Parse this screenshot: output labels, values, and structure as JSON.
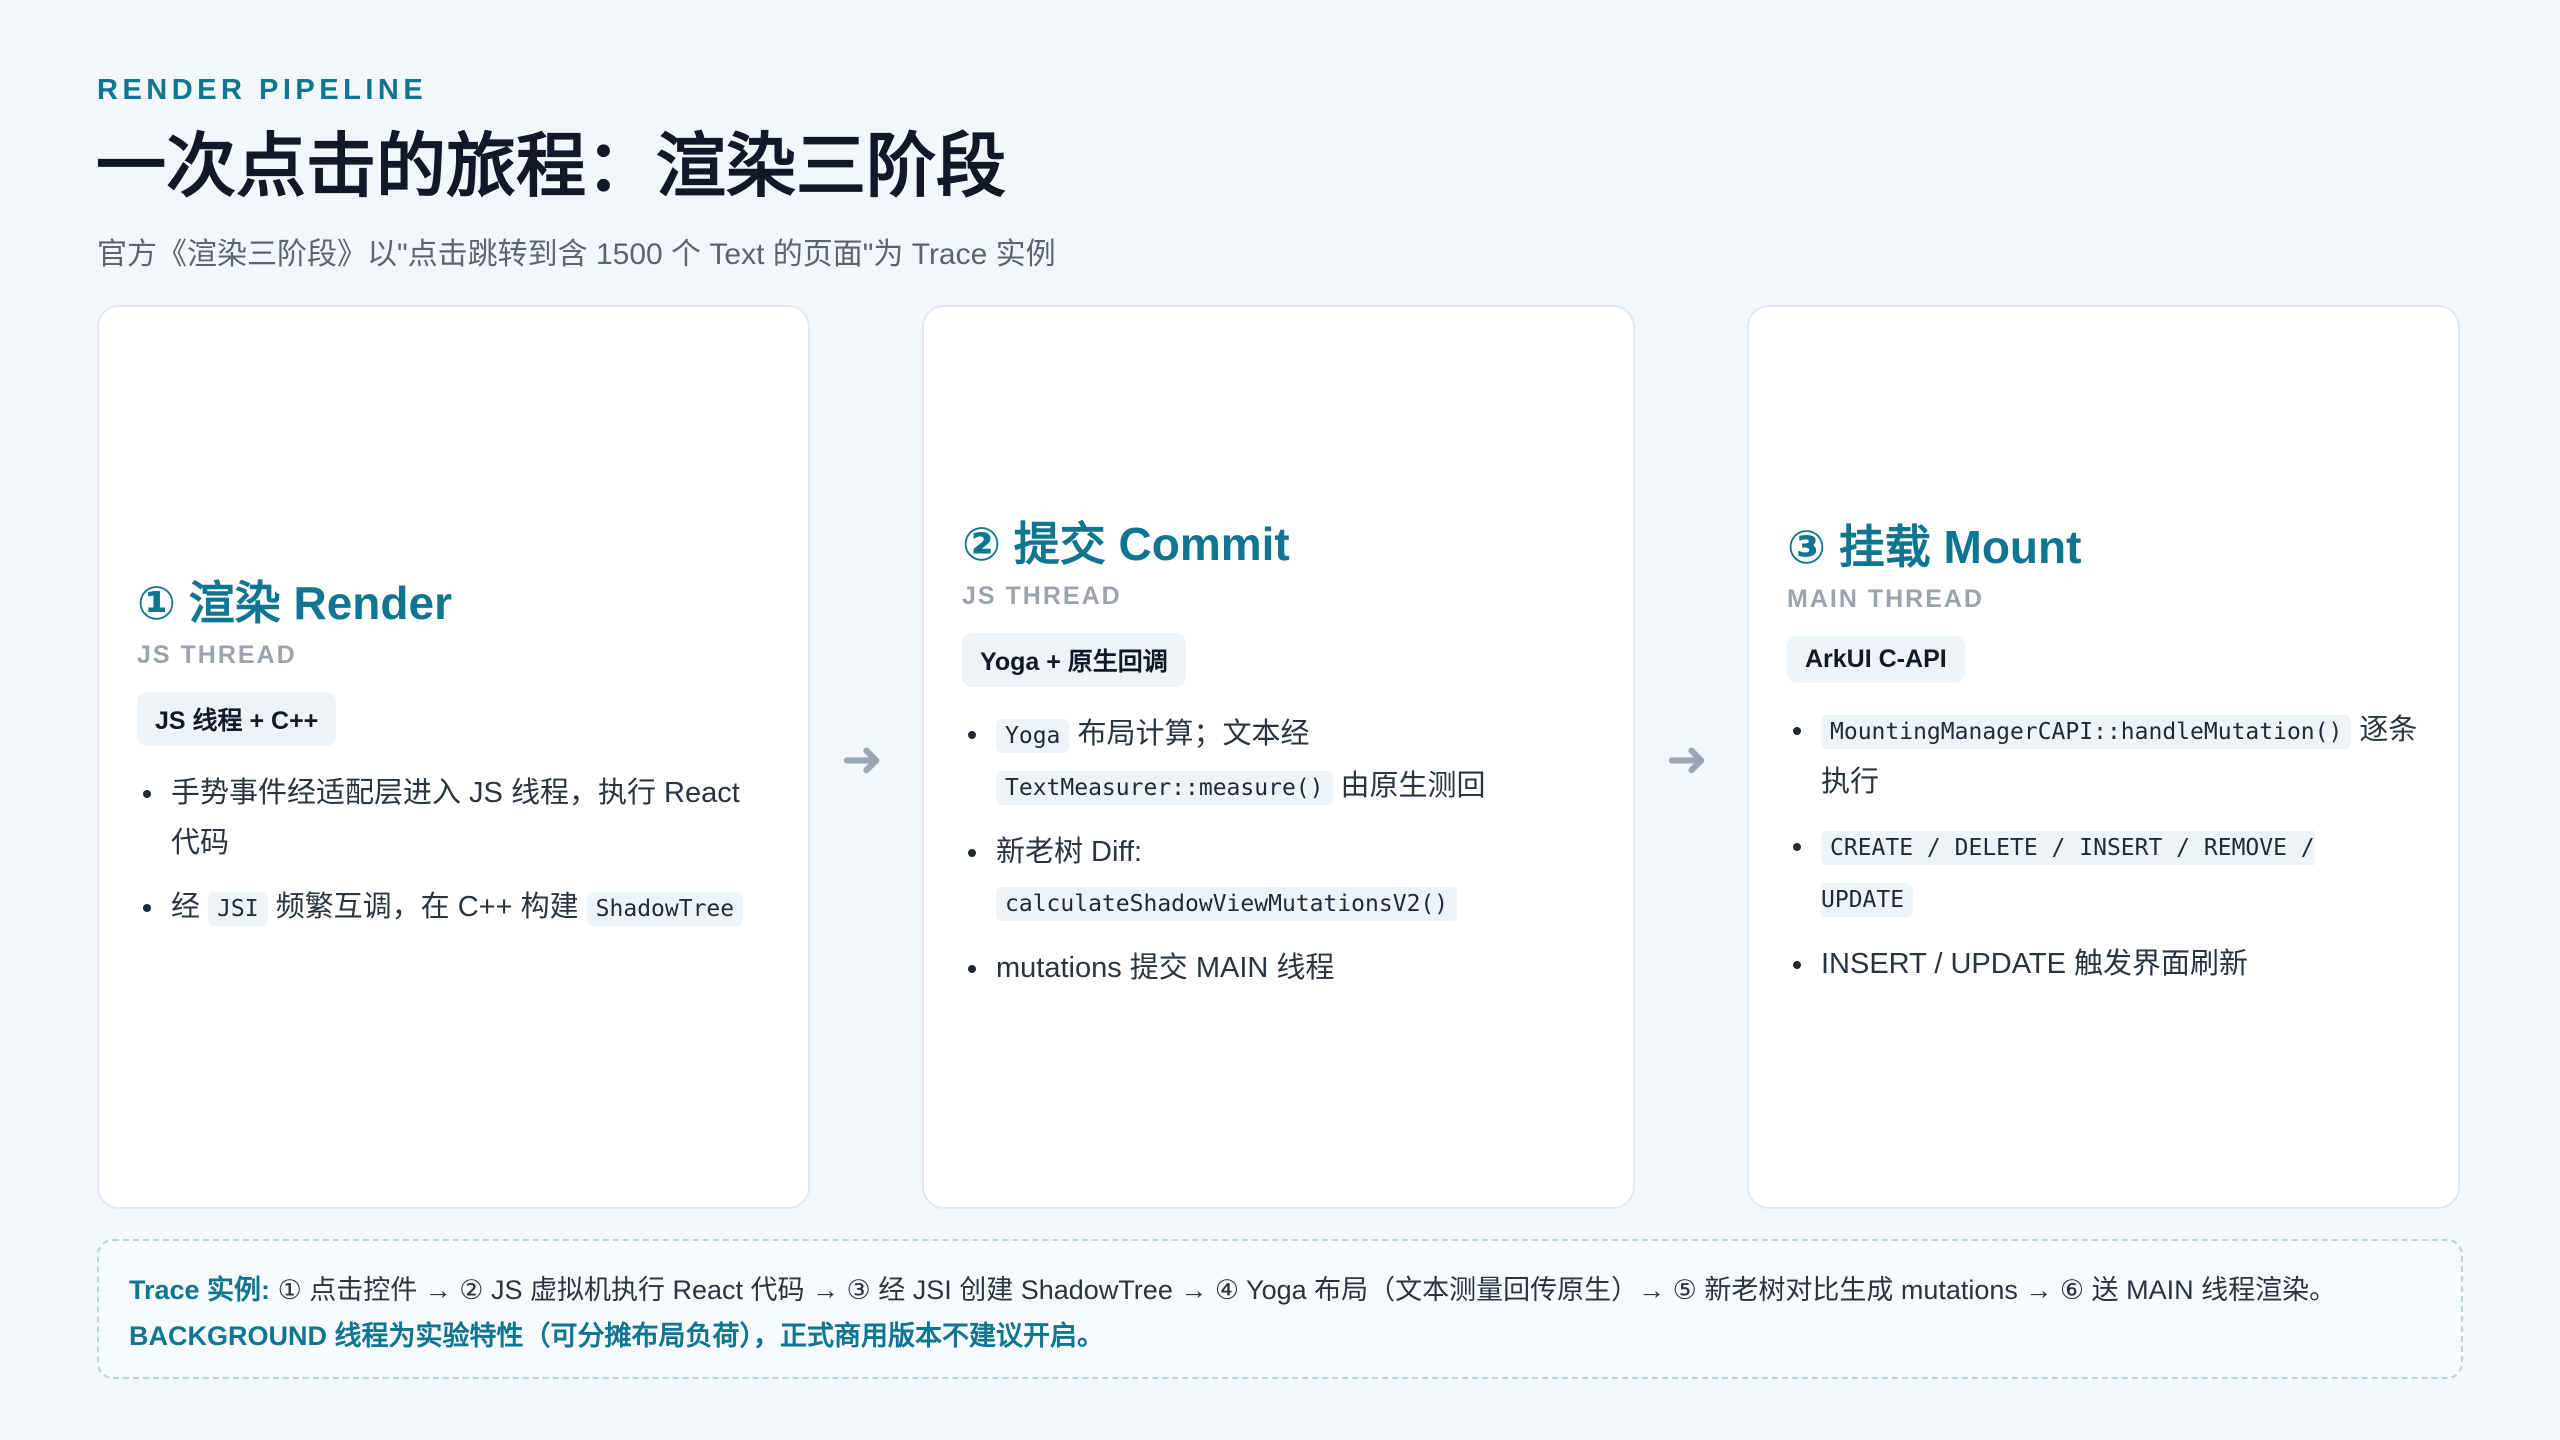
{
  "header": {
    "eyebrow": "RENDER PIPELINE",
    "title": "一次点击的旅程：渲染三阶段",
    "subtitle": "官方《渲染三阶段》以\"点击跳转到含 1500 个 Text 的页面\"为 Trace 实例"
  },
  "arrow_glyph": "➜",
  "cards": [
    {
      "title": "① 渲染 Render",
      "thread": "JS THREAD",
      "badge": "JS 线程 + C++",
      "points": [
        {
          "t1": "手势事件经适配层进入 JS 线程，执行 React 代码"
        },
        {
          "t1": "经 ",
          "c1": "JSI",
          "t2": " 频繁互调，在 C++ 构建 ",
          "c2": "ShadowTree"
        }
      ]
    },
    {
      "title": "② 提交 Commit",
      "thread": "JS THREAD",
      "badge": "Yoga + 原生回调",
      "points": [
        {
          "c1": "Yoga",
          "t1": " 布局计算；文本经 ",
          "c2": "TextMeasurer::measure()",
          "t2": " 由原生测回"
        },
        {
          "t1": "新老树 Diff: ",
          "c1": "calculateShadowViewMutationsV2()"
        },
        {
          "t1": "mutations 提交 MAIN 线程"
        }
      ]
    },
    {
      "title": "③ 挂载 Mount",
      "thread": "MAIN THREAD",
      "badge": "ArkUI C-API",
      "points": [
        {
          "c1": "MountingManagerCAPI::handleMutation()",
          "t1": " 逐条执行"
        },
        {
          "c1": "CREATE / DELETE / INSERT / REMOVE / UPDATE"
        },
        {
          "t1": "INSERT / UPDATE 触发界面刷新"
        }
      ]
    }
  ],
  "trace": {
    "label": "Trace 实例:",
    "text": " ① 点击控件 → ② JS 虚拟机执行 React 代码 → ③ 经 JSI 创建 ShadowTree → ④ Yoga 布局（文本测量回传原生）→ ⑤ 新老树对比生成 mutations → ⑥ 送 MAIN 线程渲染。",
    "note": "BACKGROUND 线程为实验特性（可分摊布局负荷），正式商用版本不建议开启。"
  }
}
